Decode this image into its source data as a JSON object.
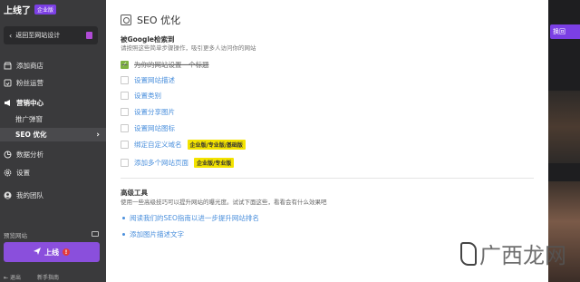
{
  "app": {
    "logo_text": "上线了",
    "edition_badge": "企业版",
    "back_label": "返回至网站设计"
  },
  "sidebar": {
    "items": [
      {
        "label": "添加商店",
        "icon": "store-icon"
      },
      {
        "label": "粉丝运营",
        "icon": "fans-icon"
      },
      {
        "label": "营销中心",
        "icon": "megaphone-icon"
      }
    ],
    "sub_items": [
      {
        "label": "推广弹窗"
      },
      {
        "label": "SEO 优化",
        "active": true
      }
    ],
    "items_after": [
      {
        "label": "数据分析",
        "icon": "chart-icon"
      },
      {
        "label": "设置",
        "icon": "gear-icon"
      },
      {
        "label": "我的团队",
        "icon": "team-icon"
      }
    ],
    "preview_label": "预览网站",
    "publish_label": "上线",
    "publish_warning": "!",
    "exit_label": "退出",
    "guide_label": "新手指南"
  },
  "panel": {
    "title": "SEO 优化",
    "section_title": "被Google检索到",
    "section_desc": "请按照这些简单步骤操作，吸引更多人访问你的网站",
    "tasks": [
      {
        "label": "为你的网站设置一个标题",
        "done": true,
        "badge": ""
      },
      {
        "label": "设置网站描述",
        "done": false,
        "badge": ""
      },
      {
        "label": "设置类别",
        "done": false,
        "badge": ""
      },
      {
        "label": "设置分享图片",
        "done": false,
        "badge": ""
      },
      {
        "label": "设置网站图标",
        "done": false,
        "badge": ""
      },
      {
        "label": "绑定自定义域名",
        "done": false,
        "badge": "企业版/专业版/基础版"
      },
      {
        "label": "添加多个网站页面",
        "done": false,
        "badge": "企业版/专业版"
      }
    ],
    "advanced_title": "高级工具",
    "advanced_desc": "使用一些高级技巧可以提升网站的曝光度。试试下面这些，看看会有什么效果吧",
    "links": [
      {
        "label": "阅读我们的SEO指南以进一步提升网站排名"
      },
      {
        "label": "添加图片描述文字"
      }
    ]
  },
  "background": {
    "right_button": "换回"
  },
  "watermark": {
    "text": "广西龙网"
  },
  "colors": {
    "accent": "#8a4fdc",
    "link": "#4a8fdc",
    "checked": "#7fb241",
    "badge": "#f3e300",
    "sidebar": "#3a3a3c"
  }
}
